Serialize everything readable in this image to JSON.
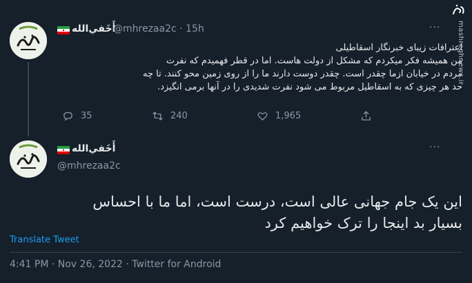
{
  "tweet1": {
    "display_name": "أَخَفي‌الله",
    "handle": "@mhrezaa2c",
    "time": "15h",
    "menu_label": "···",
    "text_lines": [
      "اعترافات زیبای خبرنگار اسقاطیلی",
      "من همیشه فکر میکردم که مشکل از دولت هاست.   اما در قطر فهمیدم که نفرت",
      "مردم در خیابان ازما چقدر است.  چقدر دوست دارند ما را از روی زمین محو کنند. تا چه",
      "حد هر چیزی که به اسقاطیل مربوط می شود نفرت شدیدی را در آنها برمی انگیزد."
    ],
    "replies": "35",
    "retweets": "240",
    "likes": "1,965"
  },
  "tweet2": {
    "display_name": "أَخَفي‌الله",
    "handle": "@mhrezaa2c",
    "menu_label": "···",
    "text_lines": [
      "این یک جام جهانی عالی است، درست است، اما ما با احساس",
      "بسیار بد اینجا را ترک خواهیم کرد"
    ],
    "translate_label": "Translate Tweet",
    "timestamp": "4:41 PM · Nov 26, 2022 · Twitter for Android"
  },
  "watermark": {
    "site": "mashreghnews.ir",
    "logo_alt": "مشرق"
  },
  "colors": {
    "background": "#15202b",
    "link": "#1d9bf0",
    "muted": "#8b98a5"
  },
  "icons": [
    "reply-icon",
    "retweet-icon",
    "like-icon",
    "share-icon",
    "iran-flag-icon",
    "more-icon"
  ]
}
